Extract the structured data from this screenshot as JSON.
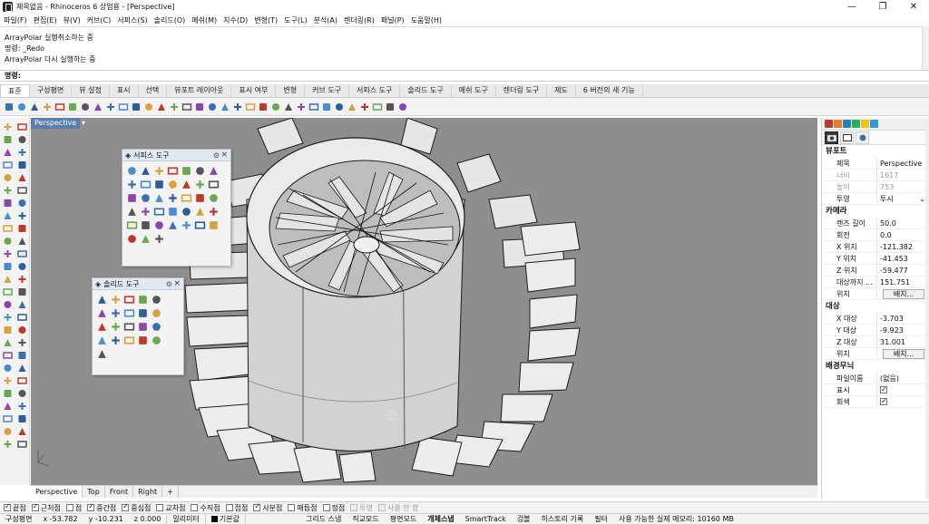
{
  "titlebar": {
    "title": "제목없음 - Rhinoceros 6 상업용 - [Perspective]",
    "minimize": "—",
    "maximize": "❐",
    "close": "✕"
  },
  "menu": [
    "파일(F)",
    "편집(E)",
    "뷰(V)",
    "커브(C)",
    "서피스(S)",
    "솔리드(O)",
    "메쉬(M)",
    "치수(D)",
    "변형(T)",
    "도구(L)",
    "분석(A)",
    "렌더링(R)",
    "패널(P)",
    "도움말(H)"
  ],
  "command_history": [
    "ArrayPolar 실행취소하는 중",
    "명령: _Redo",
    "ArrayPolar 다시 실행하는 중"
  ],
  "command_prompt": {
    "label": "명령:",
    "value": ""
  },
  "toolbar_tabs": [
    "표준",
    "구성평면",
    "뷰 설정",
    "표시",
    "선택",
    "뷰포트 레이아웃",
    "표시 여부",
    "변형",
    "커브 도구",
    "서피스 도구",
    "솔리드 도구",
    "메쉬 도구",
    "렌더링 도구",
    "제도",
    "6 버전의 새 기능"
  ],
  "active_toolbar_tab": "표준",
  "viewport": {
    "title": "Perspective",
    "background": "#8e8e8e"
  },
  "palettes": {
    "surface": {
      "title": "서피스 도구"
    },
    "solid": {
      "title": "솔리드 도구"
    }
  },
  "view_tabs": [
    "Perspective",
    "Top",
    "Front",
    "Right"
  ],
  "add_view_tab": "+",
  "osnaps": [
    {
      "label": "끝점",
      "checked": true
    },
    {
      "label": "근처점",
      "checked": true
    },
    {
      "label": "점",
      "checked": false
    },
    {
      "label": "중간점",
      "checked": true
    },
    {
      "label": "중심점",
      "checked": true
    },
    {
      "label": "교차점",
      "checked": false
    },
    {
      "label": "수직점",
      "checked": false
    },
    {
      "label": "접점",
      "checked": false
    },
    {
      "label": "사분점",
      "checked": true
    },
    {
      "label": "매듭점",
      "checked": false
    },
    {
      "label": "정점",
      "checked": false
    },
    {
      "label": "투영",
      "checked": false,
      "disabled": true
    },
    {
      "label": "사용 안 함",
      "checked": false,
      "disabled": true
    }
  ],
  "status": {
    "cplane": "구성평면",
    "x": "x -53.782",
    "y": "y -10.231",
    "z": "z 0.000",
    "units": "밀리미터",
    "layer": "기본값",
    "grid_snap": "그리드 스냅",
    "ortho": "직교모드",
    "planar": "평면모드",
    "osnap": "개체스냅",
    "smarttrack": "SmartTrack",
    "gumball": "검볼",
    "history": "히스토리 기록",
    "filter": "필터",
    "memory": "사용 가능한 실제 메모리: 10160 MB"
  },
  "properties": {
    "viewport_section": "뷰포트",
    "title_label": "제목",
    "title_value": "Perspective",
    "width_label": "너비",
    "width_value": "1617",
    "height_label": "높이",
    "height_value": "753",
    "projection_label": "투영",
    "projection_value": "투시",
    "camera_section": "카메라",
    "lens_label": "렌즈 길이",
    "lens_value": "50.0",
    "rotation_label": "회전",
    "rotation_value": "0.0",
    "xpos_label": "X 위치",
    "xpos_value": "-121.382",
    "ypos_label": "Y 위치",
    "ypos_value": "-41.453",
    "zpos_label": "Z 위치",
    "zpos_value": "-59.477",
    "dist_label": "대상까지 ...",
    "dist_value": "151.751",
    "loc_label": "위치",
    "place_button": "배치...",
    "target_section": "대상",
    "xt_label": "X 대상",
    "xt_value": "-3.703",
    "yt_label": "Y 대상",
    "yt_value": "-9.923",
    "zt_label": "Z 대상",
    "zt_value": "31.001",
    "tloc_label": "위치",
    "tplace_button": "배치...",
    "wallpaper_section": "배경무늬",
    "file_label": "파일이름",
    "file_value": "(없음)",
    "show_label": "표시",
    "gray_label": "회색"
  }
}
